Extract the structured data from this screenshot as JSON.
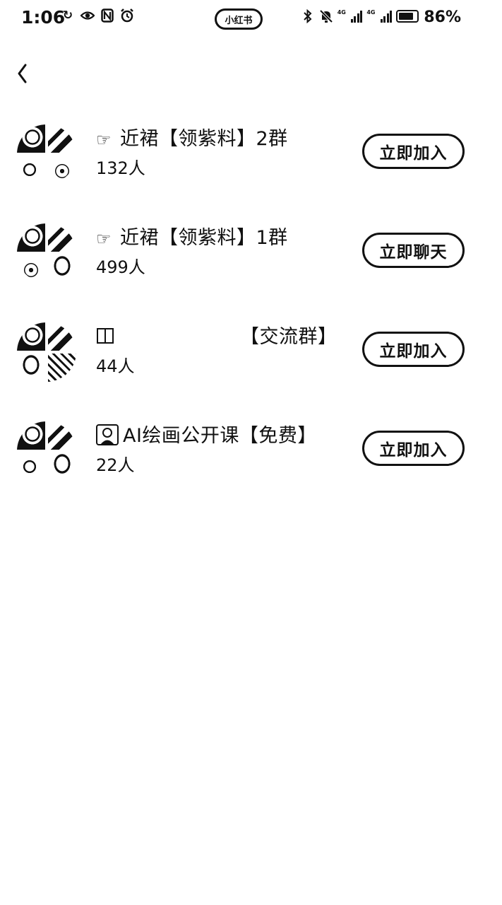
{
  "status_bar": {
    "time": "1:06",
    "center_badge": "小红书",
    "battery_percent": "86%",
    "network_1": "4G",
    "network_2": "4G"
  },
  "groups": [
    {
      "icon": "pointing-hand",
      "title": "近裙【领紫料】2群",
      "count": "132人",
      "action": "立即加入"
    },
    {
      "icon": "pointing-hand",
      "title": "近裙【领紫料】1群",
      "count": "499人",
      "action": "立即聊天"
    },
    {
      "icon": "book",
      "title_suffix": "【交流群】",
      "count": "44人",
      "action": "立即加入"
    },
    {
      "icon": "teacher",
      "title": "AI绘画公开课【免费】",
      "count": "22人",
      "action": "立即加入"
    }
  ]
}
